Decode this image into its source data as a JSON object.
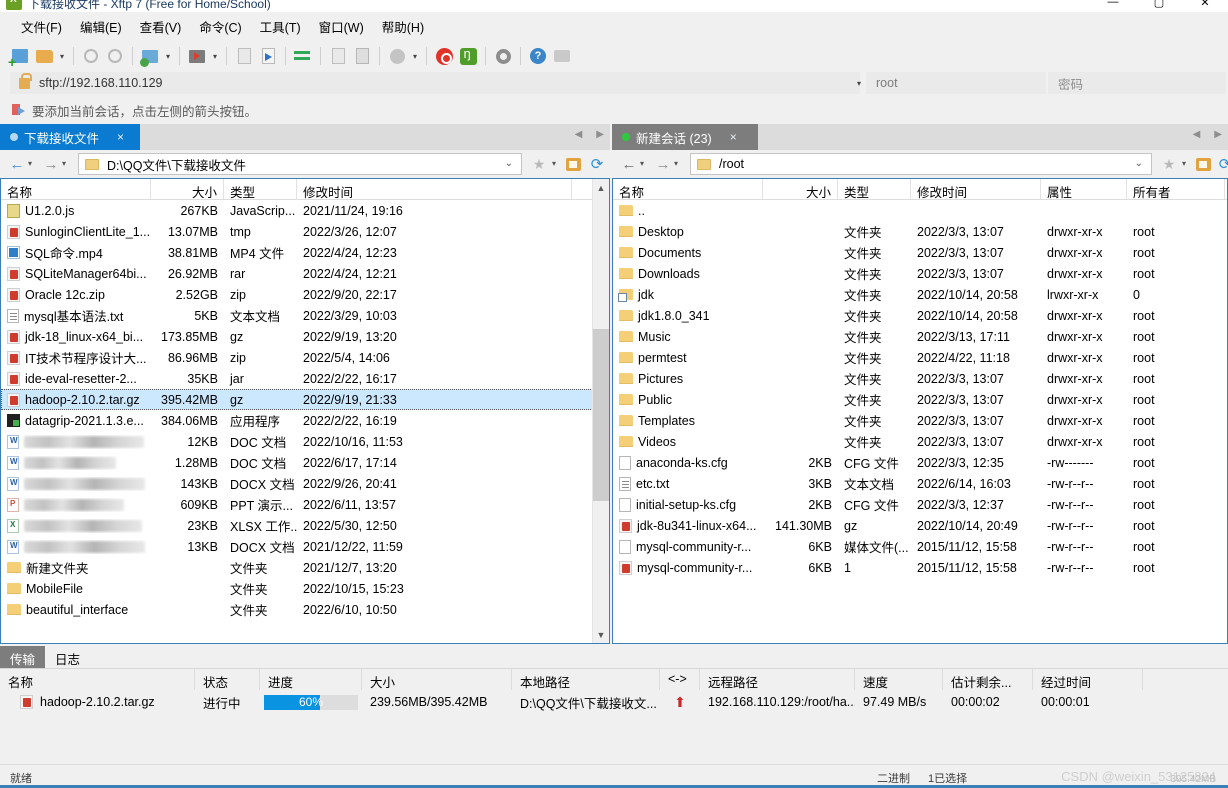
{
  "window": {
    "title": "下载接收文件 - Xftp 7 (Free for Home/School)",
    "app_icon": "xftp-icon",
    "minimize": "—",
    "maximize": "▢",
    "close": "✕"
  },
  "menubar": {
    "items": [
      {
        "label": "文件(F)",
        "name": "menu-file"
      },
      {
        "label": "编辑(E)",
        "name": "menu-edit"
      },
      {
        "label": "查看(V)",
        "name": "menu-view"
      },
      {
        "label": "命令(C)",
        "name": "menu-command"
      },
      {
        "label": "工具(T)",
        "name": "menu-tools"
      },
      {
        "label": "窗口(W)",
        "name": "menu-window"
      },
      {
        "label": "帮助(H)",
        "name": "menu-help"
      }
    ]
  },
  "toolbar": {
    "icons": [
      "new-folder-icon",
      "open-folder-icon",
      "disconnect-icon",
      "link-icon",
      "folder-properties-icon",
      "run-icon",
      "transfer-left-icon",
      "transfer-right-icon",
      "sync-icon",
      "paste-icon",
      "copy-icon",
      "status-circle-icon",
      "xshell-icon",
      "xftp-icon",
      "settings-gear-icon",
      "help-icon",
      "feedback-icon"
    ]
  },
  "address": {
    "lock_icon": "lock-icon",
    "url": "sftp://192.168.110.129",
    "dropdown_caret": "▾",
    "username": "root",
    "password_placeholder": "密码"
  },
  "hint": {
    "icon": "flag-arrow-icon",
    "text": "要添加当前会话，点击左侧的箭头按钮。"
  },
  "left_pane": {
    "tab": {
      "label": "下载接收文件",
      "dot": "grey",
      "close": "×"
    },
    "nav": {
      "back": "←",
      "forward": "→",
      "caret": "▾"
    },
    "path": "D:\\QQ文件\\下载接收文件",
    "path_folder_icon": "folder-icon",
    "path_chevron": "⌄",
    "star_icon": "star-icon",
    "home_icon": "home-icon",
    "refresh_icon": "refresh-icon",
    "columns": [
      "名称",
      "大小",
      "类型",
      "修改时间"
    ],
    "rows": [
      {
        "icon": "js-file-icon",
        "name": "U1.2.0.js",
        "size": "267KB",
        "type": "JavaScrip...",
        "mtime": "2021/11/24, 19:16",
        "blurred": false,
        "selected": false
      },
      {
        "icon": "rar-file-icon",
        "name": "SunloginClientLite_1...",
        "size": "13.07MB",
        "type": "tmp",
        "mtime": "2022/3/26, 12:07",
        "blurred": false,
        "selected": false
      },
      {
        "icon": "mp4-file-icon",
        "name": "SQL命令.mp4",
        "size": "38.81MB",
        "type": "MP4 文件",
        "mtime": "2022/4/24, 12:23",
        "blurred": false,
        "selected": false
      },
      {
        "icon": "rar-file-icon",
        "name": "SQLiteManager64bi...",
        "size": "26.92MB",
        "type": "rar",
        "mtime": "2022/4/24, 12:21",
        "blurred": false,
        "selected": false
      },
      {
        "icon": "rar-file-icon",
        "name": "Oracle 12c.zip",
        "size": "2.52GB",
        "type": "zip",
        "mtime": "2022/9/20, 22:17",
        "blurred": false,
        "selected": false
      },
      {
        "icon": "txt-file-icon",
        "name": "mysql基本语法.txt",
        "size": "5KB",
        "type": "文本文档",
        "mtime": "2022/3/29, 10:03",
        "blurred": false,
        "selected": false
      },
      {
        "icon": "rar-file-icon",
        "name": "jdk-18_linux-x64_bi...",
        "size": "173.85MB",
        "type": "gz",
        "mtime": "2022/9/19, 13:20",
        "blurred": false,
        "selected": false
      },
      {
        "icon": "rar-file-icon",
        "name": "IT技术节程序设计大...",
        "size": "86.96MB",
        "type": "zip",
        "mtime": "2022/5/4, 14:06",
        "blurred": false,
        "selected": false
      },
      {
        "icon": "rar-file-icon",
        "name": "ide-eval-resetter-2...",
        "size": "35KB",
        "type": "jar",
        "mtime": "2022/2/22, 16:17",
        "blurred": false,
        "selected": false
      },
      {
        "icon": "rar-file-icon",
        "name": "hadoop-2.10.2.tar.gz",
        "size": "395.42MB",
        "type": "gz",
        "mtime": "2022/9/19, 21:33",
        "blurred": false,
        "selected": true
      },
      {
        "icon": "exe-file-icon",
        "name": "datagrip-2021.1.3.e...",
        "size": "384.06MB",
        "type": "应用程序",
        "mtime": "2022/2/22, 16:19",
        "blurred": false,
        "selected": false
      },
      {
        "icon": "word-file-icon",
        "name": "",
        "size": "12KB",
        "type": "DOC 文档",
        "mtime": "2022/10/16, 11:53",
        "blurred": true,
        "selected": false
      },
      {
        "icon": "word-file-icon",
        "name": "",
        "size": "1.28MB",
        "type": "DOC 文档",
        "mtime": "2022/6/17, 17:14",
        "blurred": true,
        "selected": false
      },
      {
        "icon": "word-file-icon",
        "name": "",
        "size": "143KB",
        "type": "DOCX 文档",
        "mtime": "2022/9/26, 20:41",
        "blurred": true,
        "selected": false
      },
      {
        "icon": "ppt-file-icon",
        "name": "",
        "size": "609KB",
        "type": "PPT 演示...",
        "mtime": "2022/6/11, 13:57",
        "blurred": true,
        "selected": false
      },
      {
        "icon": "xls-file-icon",
        "name": "",
        "size": "23KB",
        "type": "XLSX 工作...",
        "mtime": "2022/5/30, 12:50",
        "blurred": true,
        "selected": false
      },
      {
        "icon": "word-file-icon",
        "name": "",
        "size": "13KB",
        "type": "DOCX 文档",
        "mtime": "2021/12/22, 11:59",
        "blurred": true,
        "selected": false
      },
      {
        "icon": "folder-icon",
        "name": "新建文件夹",
        "size": "",
        "type": "文件夹",
        "mtime": "2021/12/7, 13:20",
        "blurred": false,
        "selected": false
      },
      {
        "icon": "folder-icon",
        "name": "MobileFile",
        "size": "",
        "type": "文件夹",
        "mtime": "2022/10/15, 15:23",
        "blurred": false,
        "selected": false
      },
      {
        "icon": "folder-icon",
        "name": "beautiful_interface",
        "size": "",
        "type": "文件夹",
        "mtime": "2022/6/10, 10:50",
        "blurred": false,
        "selected": false
      }
    ]
  },
  "right_pane": {
    "tab": {
      "label": "新建会话 (23)",
      "dot": "green",
      "close": "×"
    },
    "nav": {
      "back": "←",
      "forward": "→",
      "caret": "▾"
    },
    "path": "/root",
    "path_folder_icon": "folder-icon",
    "path_chevron": "⌄",
    "star_icon": "star-icon",
    "home_icon": "home-icon",
    "refresh_icon": "refresh-icon",
    "columns": [
      "名称",
      "大小",
      "类型",
      "修改时间",
      "属性",
      "所有者"
    ],
    "rows": [
      {
        "icon": "folder-icon",
        "name": "..",
        "size": "",
        "type": "",
        "mtime": "",
        "attr": "",
        "owner": ""
      },
      {
        "icon": "folder-icon",
        "name": "Desktop",
        "size": "",
        "type": "文件夹",
        "mtime": "2022/3/3, 13:07",
        "attr": "drwxr-xr-x",
        "owner": "root"
      },
      {
        "icon": "folder-icon",
        "name": "Documents",
        "size": "",
        "type": "文件夹",
        "mtime": "2022/3/3, 13:07",
        "attr": "drwxr-xr-x",
        "owner": "root"
      },
      {
        "icon": "folder-icon",
        "name": "Downloads",
        "size": "",
        "type": "文件夹",
        "mtime": "2022/3/3, 13:07",
        "attr": "drwxr-xr-x",
        "owner": "root"
      },
      {
        "icon": "folder-link-icon",
        "name": "jdk",
        "size": "",
        "type": "文件夹",
        "mtime": "2022/10/14, 20:58",
        "attr": "lrwxr-xr-x",
        "owner": "0"
      },
      {
        "icon": "folder-icon",
        "name": "jdk1.8.0_341",
        "size": "",
        "type": "文件夹",
        "mtime": "2022/10/14, 20:58",
        "attr": "drwxr-xr-x",
        "owner": "root"
      },
      {
        "icon": "folder-icon",
        "name": "Music",
        "size": "",
        "type": "文件夹",
        "mtime": "2022/3/13, 17:11",
        "attr": "drwxr-xr-x",
        "owner": "root"
      },
      {
        "icon": "folder-icon",
        "name": "permtest",
        "size": "",
        "type": "文件夹",
        "mtime": "2022/4/22, 11:18",
        "attr": "drwxr-xr-x",
        "owner": "root"
      },
      {
        "icon": "folder-icon",
        "name": "Pictures",
        "size": "",
        "type": "文件夹",
        "mtime": "2022/3/3, 13:07",
        "attr": "drwxr-xr-x",
        "owner": "root"
      },
      {
        "icon": "folder-icon",
        "name": "Public",
        "size": "",
        "type": "文件夹",
        "mtime": "2022/3/3, 13:07",
        "attr": "drwxr-xr-x",
        "owner": "root"
      },
      {
        "icon": "folder-icon",
        "name": "Templates",
        "size": "",
        "type": "文件夹",
        "mtime": "2022/3/3, 13:07",
        "attr": "drwxr-xr-x",
        "owner": "root"
      },
      {
        "icon": "folder-icon",
        "name": "Videos",
        "size": "",
        "type": "文件夹",
        "mtime": "2022/3/3, 13:07",
        "attr": "drwxr-xr-x",
        "owner": "root"
      },
      {
        "icon": "plain-file-icon",
        "name": "anaconda-ks.cfg",
        "size": "2KB",
        "type": "CFG 文件",
        "mtime": "2022/3/3, 12:35",
        "attr": "-rw-------",
        "owner": "root"
      },
      {
        "icon": "txt-file-icon",
        "name": "etc.txt",
        "size": "3KB",
        "type": "文本文档",
        "mtime": "2022/6/14, 16:03",
        "attr": "-rw-r--r--",
        "owner": "root"
      },
      {
        "icon": "plain-file-icon",
        "name": "initial-setup-ks.cfg",
        "size": "2KB",
        "type": "CFG 文件",
        "mtime": "2022/3/3, 12:37",
        "attr": "-rw-r--r--",
        "owner": "root"
      },
      {
        "icon": "rar-file-icon",
        "name": "jdk-8u341-linux-x64...",
        "size": "141.30MB",
        "type": "gz",
        "mtime": "2022/10/14, 20:49",
        "attr": "-rw-r--r--",
        "owner": "root"
      },
      {
        "icon": "plain-file-icon",
        "name": "mysql-community-r...",
        "size": "6KB",
        "type": "媒体文件(...",
        "mtime": "2015/11/12, 15:58",
        "attr": "-rw-r--r--",
        "owner": "root"
      },
      {
        "icon": "rar-file-icon",
        "name": "mysql-community-r...",
        "size": "6KB",
        "type": "1",
        "mtime": "2015/11/12, 15:58",
        "attr": "-rw-r--r--",
        "owner": "root"
      }
    ]
  },
  "transfer_panel": {
    "tabs": [
      {
        "label": "传输",
        "active": true,
        "name": "tab-transfer"
      },
      {
        "label": "日志",
        "active": false,
        "name": "tab-log"
      }
    ],
    "columns": [
      "名称",
      "状态",
      "进度",
      "大小",
      "本地路径",
      "<->",
      "远程路径",
      "速度",
      "估计剩余...",
      "经过时间"
    ],
    "rows": [
      {
        "icon": "rar-file-icon",
        "name": "hadoop-2.10.2.tar.gz",
        "status": "进行中",
        "progress_percent": 60,
        "progress_label": "60%",
        "size": "239.56MB/395.42MB",
        "local_path": "D:\\QQ文件\\下载接收文...",
        "direction_icon": "up-arrow-icon",
        "remote_path": "192.168.110.129:/root/ha...",
        "speed": "97.49 MB/s",
        "eta": "00:00:02",
        "elapsed": "00:00:01"
      }
    ]
  },
  "statusbar": {
    "ready": "就绪",
    "mode": "二进制",
    "selection": "1已选择",
    "selected_size": "395.42MB",
    "watermark": "CSDN @weixin_53125824"
  },
  "colors": {
    "accent_blue": "#0a7bd0",
    "tab_grey": "#7d7d7d",
    "progress_blue": "#0a93e0",
    "selection_blue": "#cce8ff",
    "chrome": "#f0f0f0"
  }
}
